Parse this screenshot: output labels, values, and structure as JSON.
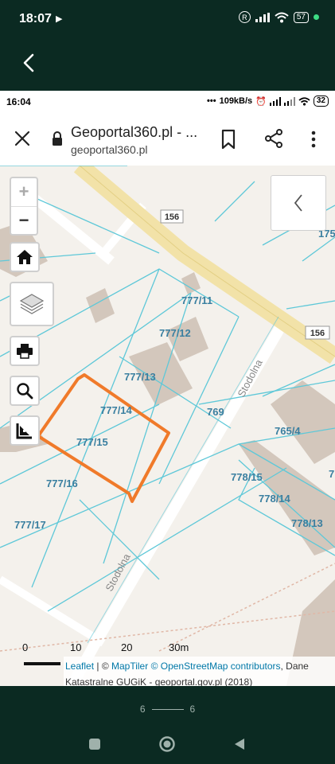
{
  "outer_status": {
    "time": "18:07",
    "battery": "57"
  },
  "inner_status": {
    "time": "16:04",
    "speed": "109kB/s",
    "battery": "32"
  },
  "browser": {
    "title": "Geoportal360.pl - ...",
    "domain": "geoportal360.pl"
  },
  "map": {
    "parcels": [
      "777/11",
      "777/12",
      "777/13",
      "777/14",
      "777/15",
      "777/16",
      "777/17",
      "769",
      "765/4",
      "778/15",
      "778/14",
      "778/13",
      "175",
      "7"
    ],
    "road_numbers": [
      "156",
      "156"
    ],
    "streets": [
      "Stodolna",
      "Stodolna"
    ],
    "highlight_color": "#f07a2a",
    "parcel_line_color": "#5ec8d8"
  },
  "controls": {
    "zoom_in": "+",
    "zoom_out": "−"
  },
  "scale": {
    "labels": [
      "0",
      "10",
      "20",
      "30m"
    ]
  },
  "attribution": {
    "leaflet": "Leaflet",
    "sep": " | © ",
    "maptiler": "MapTiler",
    "osm": "© OpenStreetMap contributors",
    "rest": ", Dane Katastralne GUGiK - geoportal.gov.pl (2018)"
  },
  "pager": {
    "current": "6",
    "total": "6"
  }
}
